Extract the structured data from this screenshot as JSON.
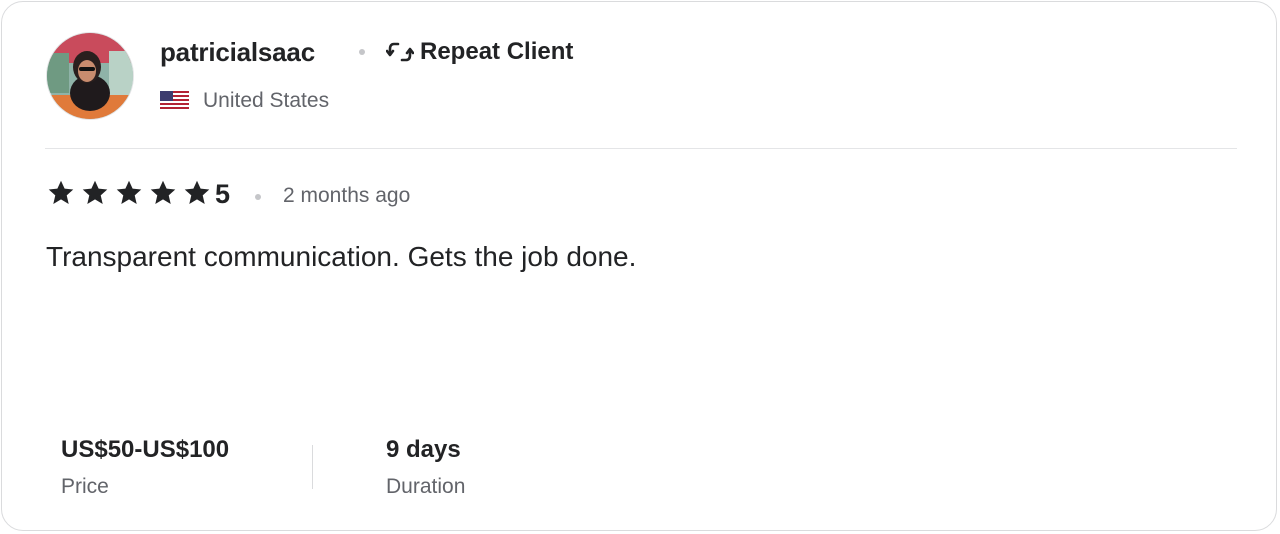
{
  "review": {
    "username": "patricialsaac",
    "badge_label": "Repeat Client",
    "badge_icon": "repeat-icon",
    "country": "United States",
    "country_flag": "us-flag-icon",
    "rating_value": "5",
    "stars_filled": 5,
    "time_ago": "2 months ago",
    "text": "Transparent communication. Gets the job done.",
    "price_value": "US$50-US$100",
    "price_label": "Price",
    "duration_value": "9 days",
    "duration_label": "Duration"
  },
  "colors": {
    "text_primary": "#222325",
    "text_secondary": "#62646a",
    "border": "#dadbdd"
  }
}
